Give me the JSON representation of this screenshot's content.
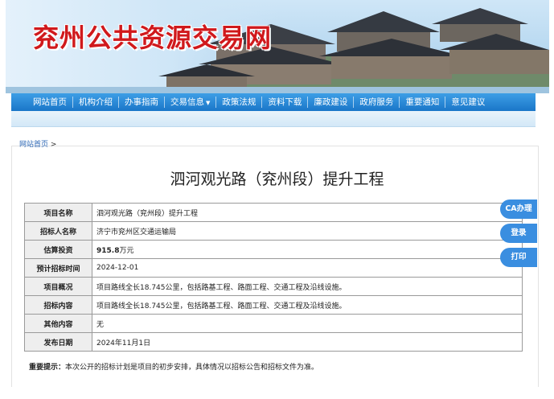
{
  "header": {
    "site_title": "兖州公共资源交易网"
  },
  "nav": {
    "items": [
      "网站首页",
      "机构介绍",
      "办事指南",
      "交易信息",
      "政策法规",
      "资料下载",
      "廉政建设",
      "政府服务",
      "重要通知",
      "意见建议"
    ],
    "dropdown_item": "交易信息"
  },
  "breadcrumb": {
    "home": "网站首页",
    "separator": ">"
  },
  "document": {
    "title": "泗河观光路（兖州段）提升工程",
    "rows": [
      {
        "label": "项目名称",
        "value": "泗河观光路（兖州段）提升工程"
      },
      {
        "label": "招标人名称",
        "value": "济宁市兖州区交通运输局"
      },
      {
        "label": "估算投资",
        "value": "915.8",
        "unit": "万元"
      },
      {
        "label": "预计招标时间",
        "value": "2024-12-01"
      },
      {
        "label": "项目概况",
        "value": "项目路线全长18.745公里，包括路基工程、路面工程、交通工程及沿线设施。"
      },
      {
        "label": "招标内容",
        "value": "项目路线全长18.745公里，包括路基工程、路面工程、交通工程及沿线设施。"
      },
      {
        "label": "其他内容",
        "value": "无"
      },
      {
        "label": "发布日期",
        "value": "2024年11月1日"
      }
    ],
    "note_label": "重要提示：",
    "note_text": "本次公开的招标计划是项目的初步安排，具体情况以招标公告和招标文件为准。"
  },
  "side_buttons": {
    "ca": "CA办理",
    "login": "登录",
    "print": "打印"
  },
  "colors": {
    "title_red": "#d0191c",
    "nav_blue": "#1a76c8",
    "side_blue": "#3a8ee0"
  }
}
